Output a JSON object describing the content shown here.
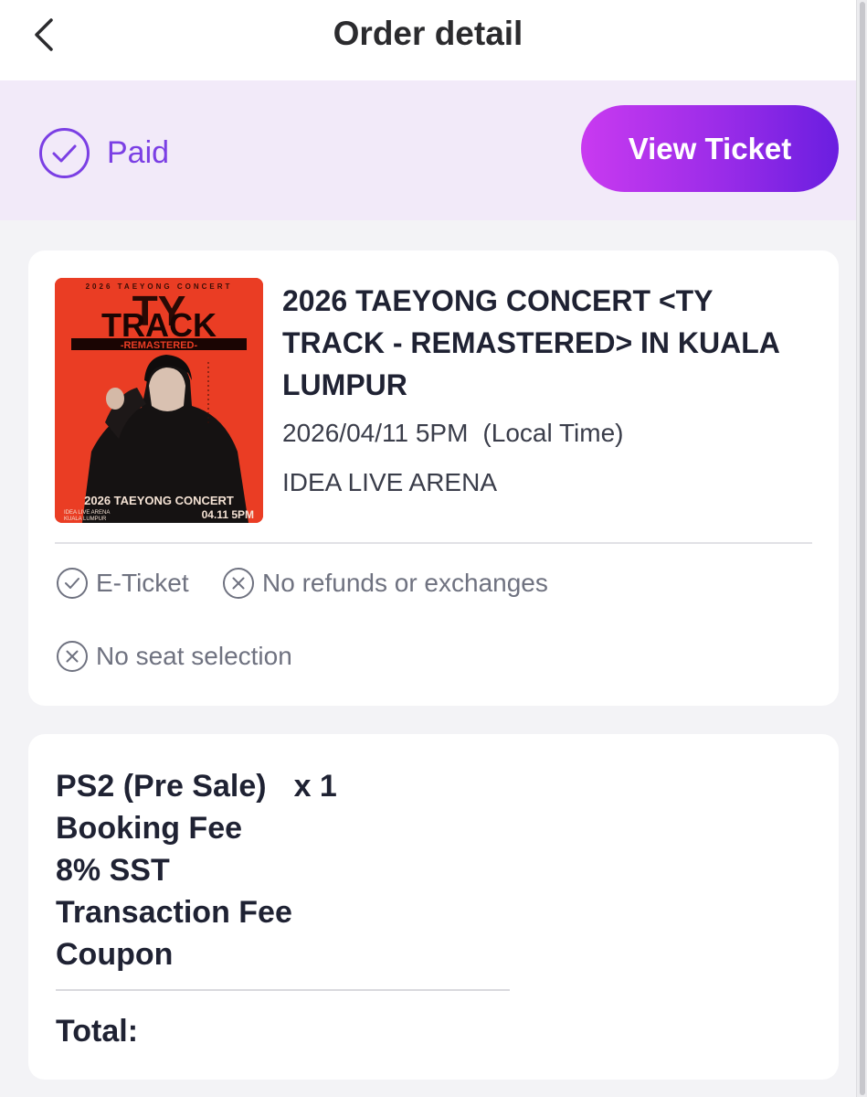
{
  "header": {
    "title": "Order detail",
    "back_icon": "chevron-left-icon"
  },
  "status": {
    "label": "Paid",
    "icon": "check-circle-icon",
    "accent_color": "#7b3fe4",
    "view_ticket_label": "View Ticket"
  },
  "event": {
    "title": "2026 TAEYONG CONCERT <TY TRACK - REMASTERED> IN KUALA LUMPUR",
    "date": "2026/04/11 5PM",
    "timezone_note": "(Local Time)",
    "venue": "IDEA LIVE ARENA",
    "poster": {
      "top_text": "2026 TAEYONG CONCERT",
      "big_letters": "TY",
      "track_text": "TRACK",
      "remastered_text": "-REMASTERED-",
      "bottom_title": "2026 TAEYONG CONCERT",
      "venue_line1": "IDEA LIVE ARENA",
      "venue_line2": "KUALA LUMPUR",
      "date_time": "04.11 5PM",
      "background_color": "#ea3d24"
    }
  },
  "features": [
    {
      "icon": "check-circle-icon",
      "label": "E-Ticket"
    },
    {
      "icon": "x-circle-icon",
      "label": "No refunds or exchanges"
    },
    {
      "icon": "x-circle-icon",
      "label": "No seat selection"
    }
  ],
  "order": {
    "items": [
      {
        "label": "PS2 (Pre Sale)",
        "qty": "x 1"
      },
      {
        "label": "Booking Fee"
      },
      {
        "label": "8% SST"
      },
      {
        "label": "Transaction Fee"
      },
      {
        "label": "Coupon"
      }
    ],
    "total_label": "Total:"
  }
}
